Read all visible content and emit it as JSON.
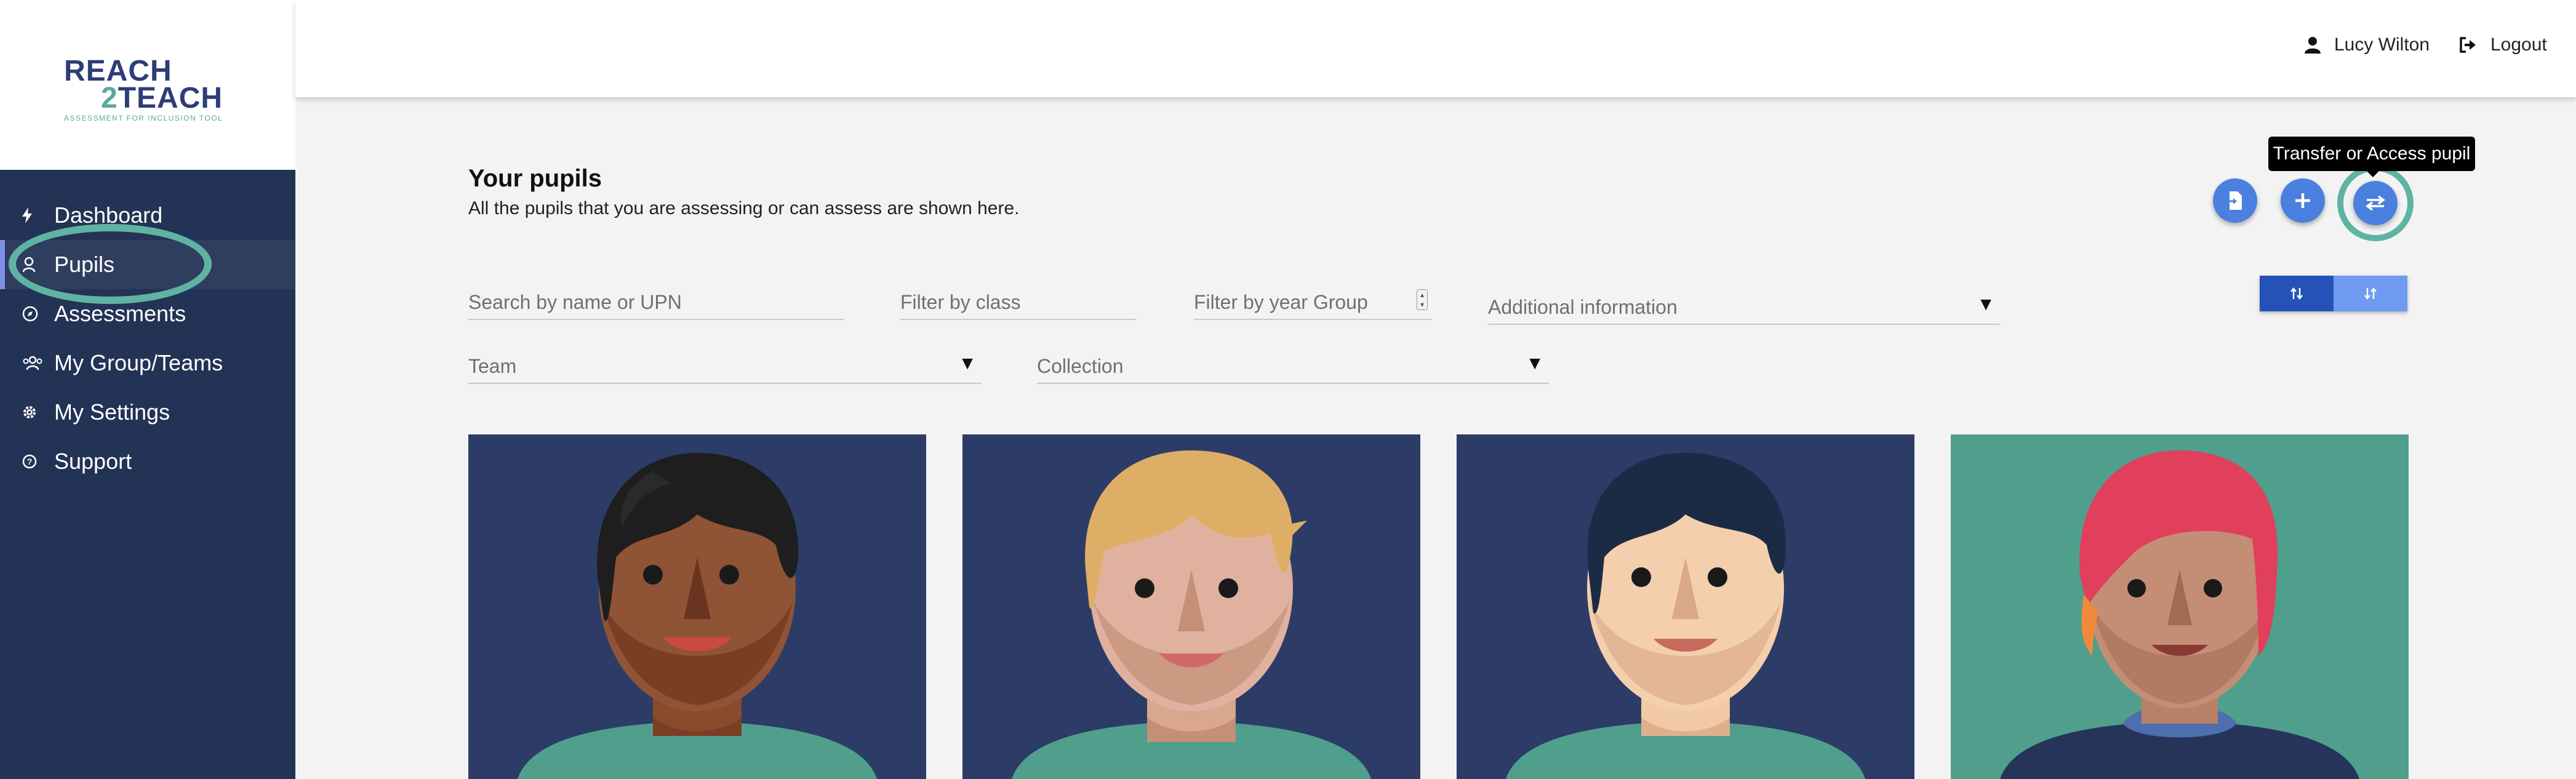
{
  "sidebar": {
    "logo": {
      "line1": "REACH",
      "line2_num": "2",
      "line2_word": "TEACH",
      "tagline": "ASSESSMENT FOR INCLUSION TOOL"
    },
    "items": [
      {
        "label": "Dashboard",
        "icon": "bolt-icon"
      },
      {
        "label": "Pupils",
        "icon": "person-icon"
      },
      {
        "label": "Assessments",
        "icon": "compass-icon"
      },
      {
        "label": "My Group/Teams",
        "icon": "group-icon"
      },
      {
        "label": "My Settings",
        "icon": "gear-icon"
      },
      {
        "label": "Support",
        "icon": "help-icon"
      }
    ],
    "active": "Pupils"
  },
  "header": {
    "user_name": "Lucy Wilton",
    "logout_label": "Logout"
  },
  "main": {
    "title": "Your pupils",
    "subtitle": "All the pupils that you are assessing or can assess are shown here.",
    "tooltip": "Transfer or Access pupil",
    "filters": {
      "search_placeholder": "Search by name or UPN",
      "class_placeholder": "Filter by class",
      "year_placeholder": "Filter by year Group",
      "additional_placeholder": "Additional information",
      "team_placeholder": "Team",
      "collection_placeholder": "Collection"
    }
  },
  "colors": {
    "sidebar": "#223355",
    "accent": "#5fb3a3",
    "fab": "#4b7fe0",
    "sort_on": "#2452b8",
    "sort_off": "#6f9bf0"
  }
}
